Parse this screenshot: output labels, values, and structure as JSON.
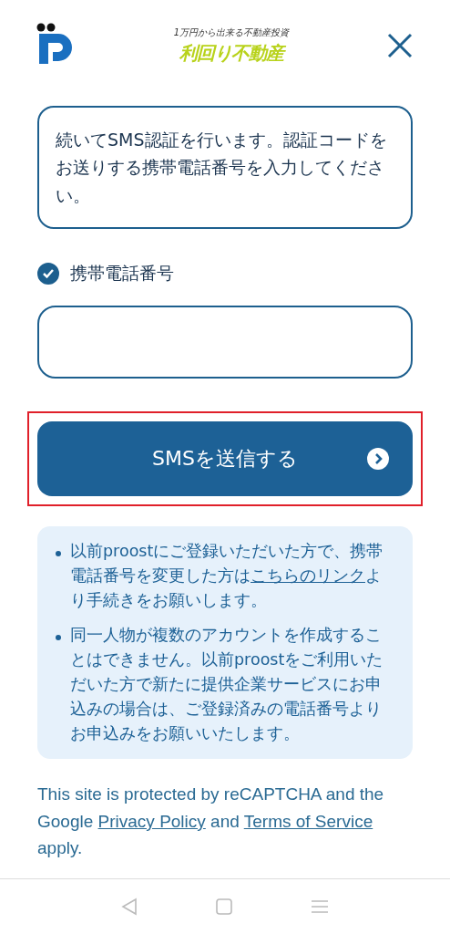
{
  "header": {
    "tagline": "1万円から出来る不動産投資",
    "brand": "利回り不動産"
  },
  "message": "続いてSMS認証を行います。認証コードをお送りする携帯電話番号を入力してください。",
  "phone_field": {
    "label": "携帯電話番号",
    "checked": true
  },
  "submit_button": {
    "label": "SMSを送信する",
    "highlighted": true
  },
  "notices": [
    {
      "before": "以前proostにご登録いただいた方で、携帯電話番号を変更した方は",
      "link": "こちらのリンク",
      "after": "より手続きをお願いします。"
    },
    {
      "before": "同一人物が複数のアカウントを作成することはできません。以前proostをご利用いただいた方で新たに提供企業サービスにお申込みの場合は、ご登録済みの電話番号よりお申込みをお願いいたします。"
    }
  ],
  "footer": {
    "before": "This site is protected by reCAPTCHA and the Google",
    "privacy_link": "Privacy Policy",
    "middle": "and",
    "terms_link": "Terms of Service",
    "after": "apply."
  }
}
